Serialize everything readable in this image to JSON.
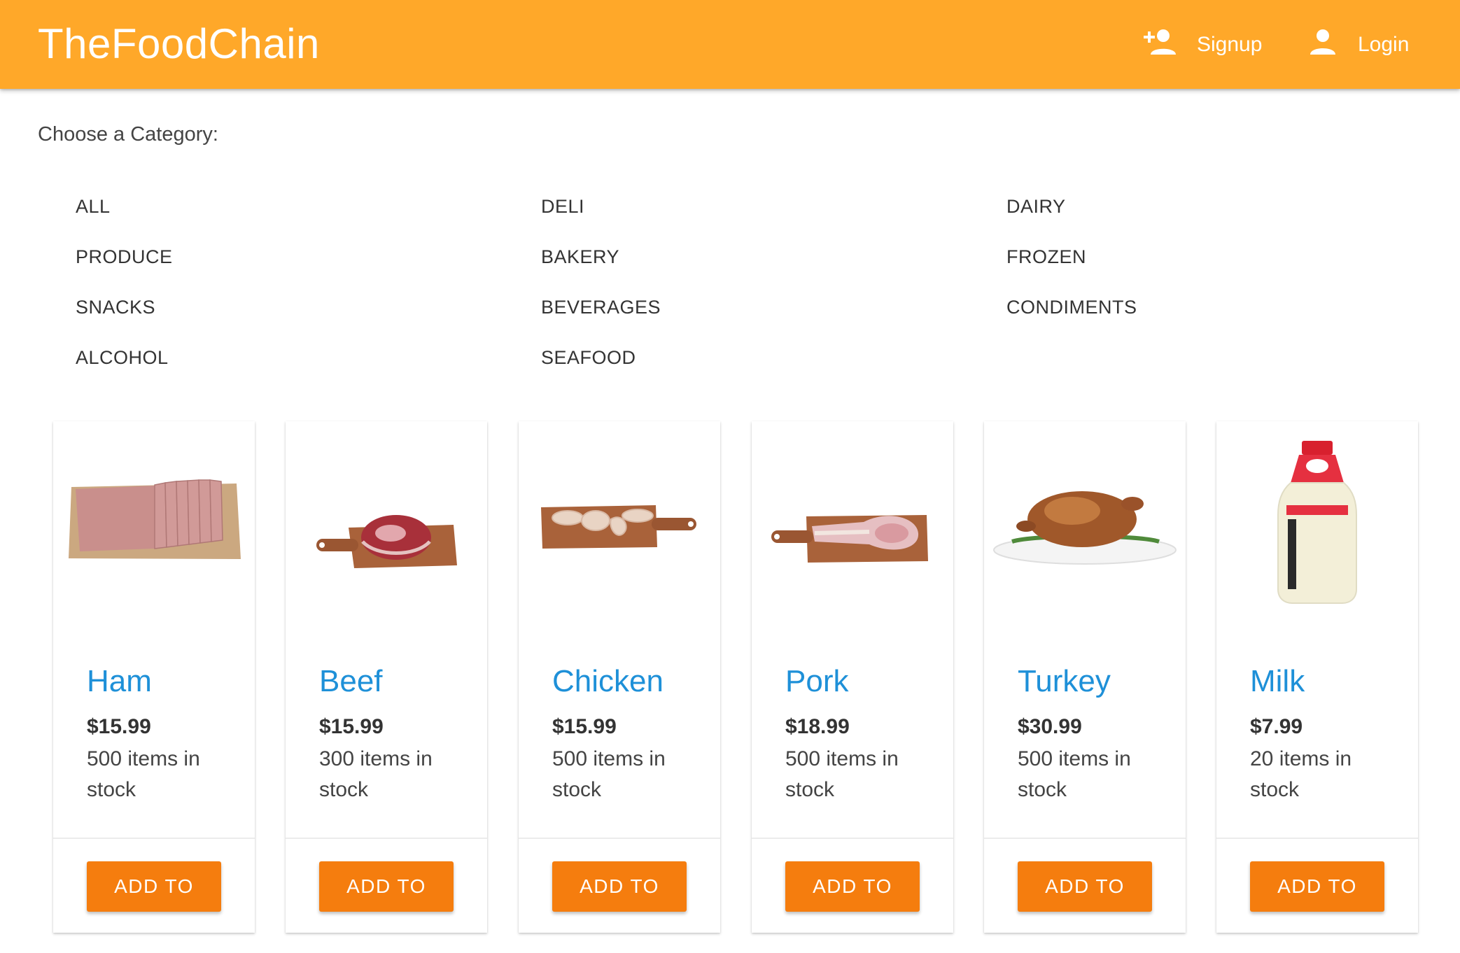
{
  "app": {
    "title": "TheFoodChain"
  },
  "nav": {
    "signup": {
      "label": "Signup",
      "icon": "person-add-icon"
    },
    "login": {
      "label": "Login",
      "icon": "person-icon"
    }
  },
  "categories": {
    "heading": "Choose a Category:",
    "items": [
      "ALL",
      "DELI",
      "DAIRY",
      "PRODUCE",
      "BAKERY",
      "FROZEN",
      "SNACKS",
      "BEVERAGES",
      "CONDIMENTS",
      "ALCOHOL",
      "SEAFOOD"
    ]
  },
  "products": [
    {
      "name": "Ham",
      "price": "$15.99",
      "stock": "500 items in stock",
      "button": "ADD TO"
    },
    {
      "name": "Beef",
      "price": "$15.99",
      "stock": "300 items in stock",
      "button": "ADD TO"
    },
    {
      "name": "Chicken",
      "price": "$15.99",
      "stock": "500 items in stock",
      "button": "ADD TO"
    },
    {
      "name": "Pork",
      "price": "$18.99",
      "stock": "500 items in stock",
      "button": "ADD TO"
    },
    {
      "name": "Turkey",
      "price": "$30.99",
      "stock": "500 items in stock",
      "button": "ADD TO"
    },
    {
      "name": "Milk",
      "price": "$7.99",
      "stock": "20 items in stock",
      "button": "ADD TO"
    }
  ],
  "colors": {
    "appbar": "#ffa829",
    "product_name": "#1e90d8",
    "add_button": "#f57d0e"
  }
}
